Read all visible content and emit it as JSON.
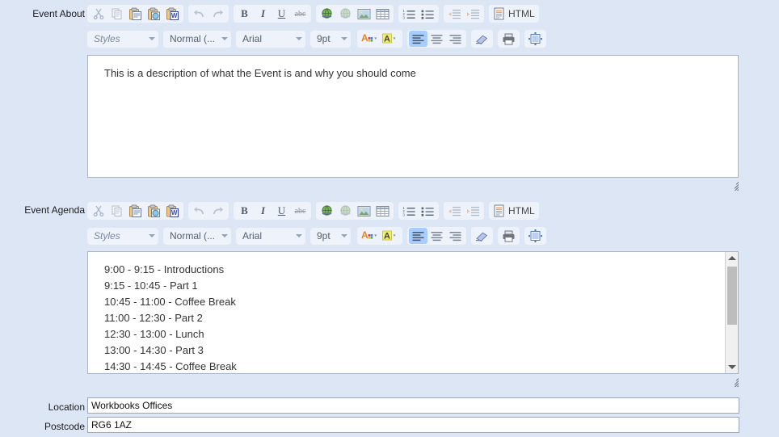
{
  "page": {
    "background_color": "#dde6f5",
    "accent_color": "#a8ceff"
  },
  "fields": [
    {
      "key": "event_about",
      "label": "Event About",
      "type": "rich-text-editor",
      "value": "This is a description of what the Event is and why you should come",
      "has_scrollbar": false
    },
    {
      "key": "event_agenda",
      "label": "Event Agenda",
      "type": "rich-text-editor",
      "value": "9:00 - 9:15 - Introductions\n9:15 - 10:45 - Part 1\n10:45 - 11:00 - Coffee Break\n11:00 - 12:30 - Part 2\n12:30 - 13:00 - Lunch\n13:00 - 14:30 - Part 3\n14:30 - 14:45 - Coffee Break",
      "has_scrollbar": true
    },
    {
      "key": "location",
      "label": "Location",
      "type": "text",
      "value": "Workbooks Offices",
      "placeholder": ""
    },
    {
      "key": "postcode",
      "label": "Postcode",
      "type": "text",
      "value": "RG6 1AZ",
      "placeholder": ""
    }
  ],
  "toolbar": {
    "row1": [
      {
        "group": "clipboard",
        "buttons": [
          {
            "name": "cut-icon",
            "title": "Cut",
            "state": "disabled"
          },
          {
            "name": "copy-icon",
            "title": "Copy",
            "state": "disabled"
          },
          {
            "name": "paste-icon",
            "title": "Paste",
            "state": "enabled"
          },
          {
            "name": "paste-plain-text-icon",
            "title": "Paste as plain text",
            "state": "enabled"
          },
          {
            "name": "paste-from-word-icon",
            "title": "Paste from Word",
            "state": "enabled"
          }
        ]
      },
      {
        "group": "history",
        "buttons": [
          {
            "name": "undo-icon",
            "title": "Undo",
            "state": "disabled"
          },
          {
            "name": "redo-icon",
            "title": "Redo",
            "state": "disabled"
          }
        ]
      },
      {
        "group": "basic-styles",
        "buttons": [
          {
            "name": "bold-icon",
            "title": "Bold",
            "state": "enabled",
            "glyph": "B"
          },
          {
            "name": "italic-icon",
            "title": "Italic",
            "state": "enabled",
            "glyph": "I"
          },
          {
            "name": "underline-icon",
            "title": "Underline",
            "state": "enabled",
            "glyph": "U"
          },
          {
            "name": "strikethrough-icon",
            "title": "Strike Through",
            "state": "enabled",
            "glyph": "abc"
          }
        ]
      },
      {
        "group": "links",
        "buttons": [
          {
            "name": "link-icon",
            "title": "Link",
            "state": "enabled"
          },
          {
            "name": "unlink-icon",
            "title": "Unlink",
            "state": "disabled"
          },
          {
            "name": "image-icon",
            "title": "Image",
            "state": "enabled"
          },
          {
            "name": "table-icon",
            "title": "Table",
            "state": "enabled"
          }
        ]
      },
      {
        "group": "lists",
        "buttons": [
          {
            "name": "numbered-list-icon",
            "title": "Insert/Remove Numbered List",
            "state": "enabled"
          },
          {
            "name": "bulleted-list-icon",
            "title": "Insert/Remove Bulleted List",
            "state": "enabled"
          }
        ]
      },
      {
        "group": "indent",
        "buttons": [
          {
            "name": "outdent-icon",
            "title": "Decrease Indent",
            "state": "disabled"
          },
          {
            "name": "indent-icon",
            "title": "Increase Indent",
            "state": "disabled"
          }
        ]
      },
      {
        "group": "source",
        "buttons": [
          {
            "name": "html-source-icon",
            "title": "HTML",
            "state": "enabled",
            "label": "HTML"
          }
        ]
      }
    ],
    "row2": {
      "selects": [
        {
          "name": "styles-select",
          "value": "Styles"
        },
        {
          "name": "paragraph-format-select",
          "value": "Normal (..."
        },
        {
          "name": "font-family-select",
          "value": "Arial"
        },
        {
          "name": "font-size-select",
          "value": "9pt"
        }
      ],
      "colors": [
        {
          "name": "text-color-icon",
          "title": "Text Color"
        },
        {
          "name": "background-color-icon",
          "title": "Background Color"
        }
      ],
      "align": [
        {
          "name": "align-left-icon",
          "title": "Align Left",
          "state": "active"
        },
        {
          "name": "align-center-icon",
          "title": "Center",
          "state": "enabled"
        },
        {
          "name": "align-right-icon",
          "title": "Align Right",
          "state": "enabled"
        }
      ],
      "tools": [
        {
          "name": "remove-format-icon",
          "title": "Remove Format"
        },
        {
          "name": "print-icon",
          "title": "Print"
        },
        {
          "name": "templates-icon",
          "title": "Templates"
        }
      ]
    }
  },
  "scrollbar": {
    "up_arrow": "scroll-up-arrow-icon",
    "down_arrow": "scroll-down-arrow-icon",
    "thumb": "scroll-thumb"
  }
}
